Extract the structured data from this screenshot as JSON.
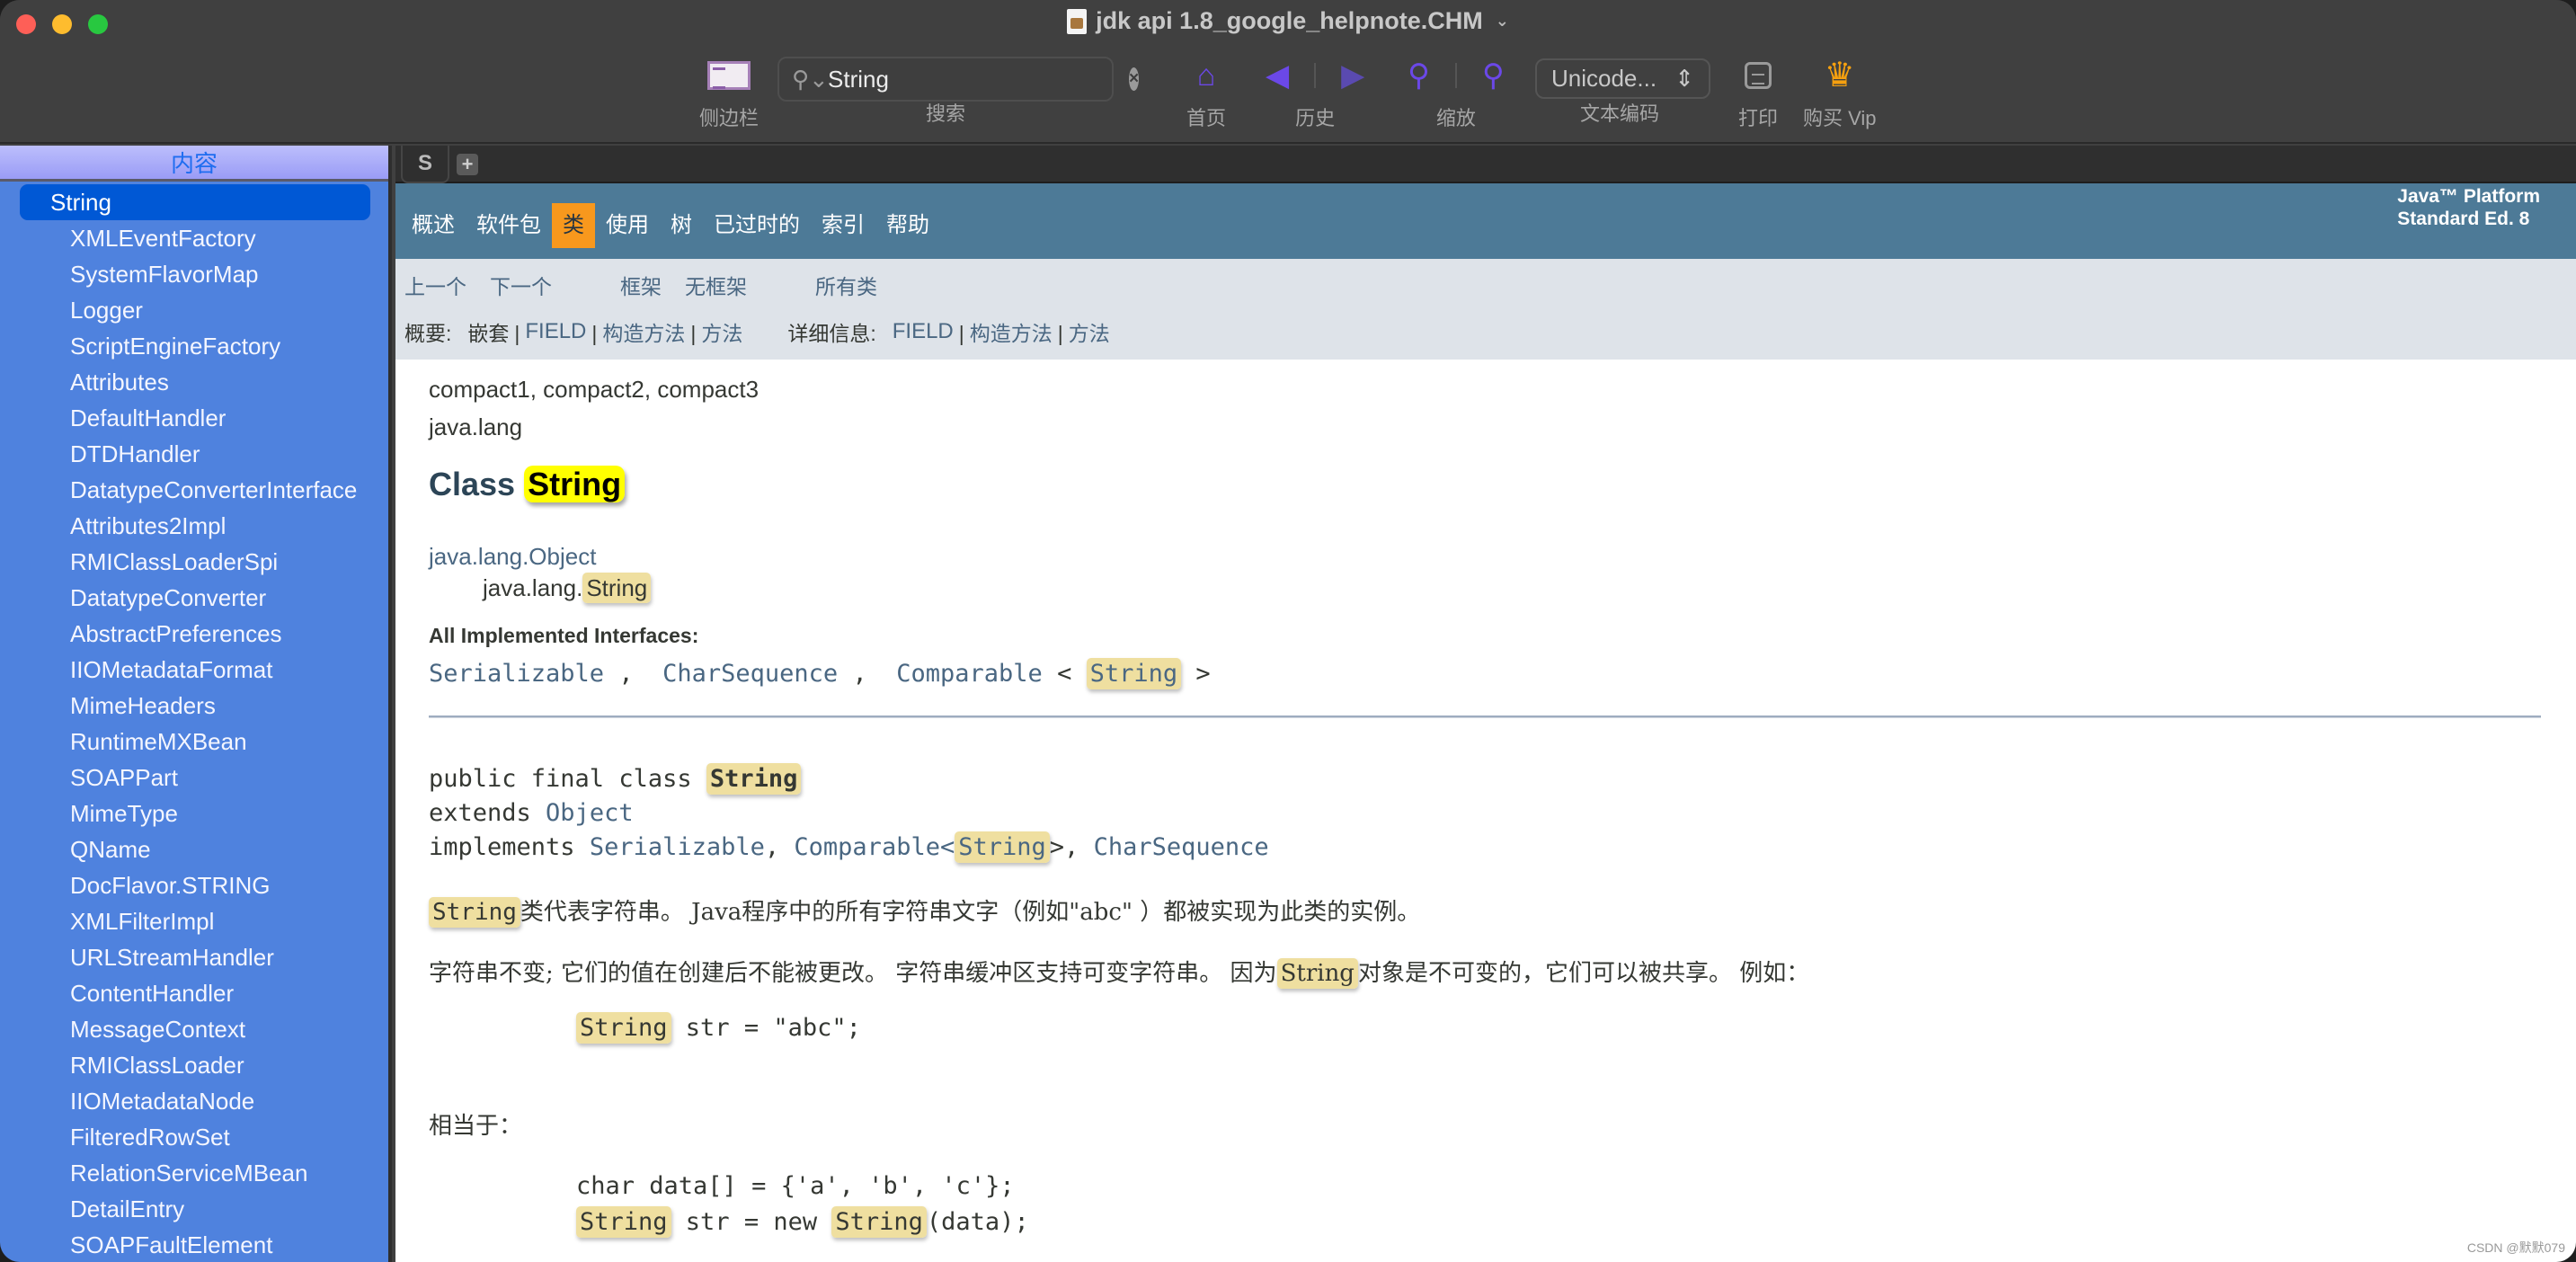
{
  "window": {
    "title": "jdk api 1.8_google_helpnote.CHM",
    "title_chevron": "⌄"
  },
  "toolbar": {
    "sidebar_label": "侧边栏",
    "search_label": "搜索",
    "search_value": "String",
    "search_clear": "×",
    "home_label": "首页",
    "history_label": "历史",
    "zoom_label": "缩放",
    "encoding_value": "Unicode...",
    "encoding_label": "文本编码",
    "print_label": "打印",
    "vip_label": "购买 Vip",
    "icons": {
      "home": "⌂",
      "back": "◀",
      "forward": "▶",
      "zoom_in": "⚲",
      "zoom_out": "⚲",
      "crown": "♛",
      "search": "⚲",
      "updown": "⇕"
    }
  },
  "sidebar": {
    "header": "内容",
    "items": [
      {
        "label": "String",
        "selected": true
      },
      {
        "label": "XMLEventFactory"
      },
      {
        "label": "SystemFlavorMap"
      },
      {
        "label": "Logger"
      },
      {
        "label": "ScriptEngineFactory"
      },
      {
        "label": "Attributes"
      },
      {
        "label": "DefaultHandler"
      },
      {
        "label": "DTDHandler"
      },
      {
        "label": "DatatypeConverterInterface"
      },
      {
        "label": "Attributes2Impl"
      },
      {
        "label": "RMIClassLoaderSpi"
      },
      {
        "label": "DatatypeConverter"
      },
      {
        "label": "AbstractPreferences"
      },
      {
        "label": "IIOMetadataFormat"
      },
      {
        "label": "MimeHeaders"
      },
      {
        "label": "RuntimeMXBean"
      },
      {
        "label": "SOAPPart"
      },
      {
        "label": "MimeType"
      },
      {
        "label": "QName"
      },
      {
        "label": "DocFlavor.STRING"
      },
      {
        "label": "XMLFilterImpl"
      },
      {
        "label": "URLStreamHandler"
      },
      {
        "label": "ContentHandler"
      },
      {
        "label": "MessageContext"
      },
      {
        "label": "RMIClassLoader"
      },
      {
        "label": "IIOMetadataNode"
      },
      {
        "label": "FilteredRowSet"
      },
      {
        "label": "RelationServiceMBean"
      },
      {
        "label": "DetailEntry"
      },
      {
        "label": "SOAPFaultElement"
      }
    ]
  },
  "tabs": {
    "active": "S",
    "add": "+"
  },
  "topnav": {
    "items": [
      "概述",
      "软件包",
      "类",
      "使用",
      "树",
      "已过时的",
      "索引",
      "帮助"
    ],
    "active_index": 2,
    "platform_line1": "Java™ Platform",
    "platform_line2": "Standard Ed. 8"
  },
  "subnav": {
    "prev": "上一个",
    "next": "下一个",
    "frames": "框架",
    "no_frames": "无框架",
    "all_classes": "所有类",
    "summary_label": "概要:",
    "summary_nested": "嵌套",
    "summary_field": "FIELD",
    "summary_constr": "构造方法",
    "summary_method": "方法",
    "detail_label": "详细信息:",
    "detail_field": "FIELD",
    "detail_constr": "构造方法",
    "detail_method": "方法",
    "pipe": "|"
  },
  "doc": {
    "profiles": "compact1, compact2, compact3",
    "package": "java.lang",
    "class_prefix": "Class",
    "class_name": "String",
    "inherit_parent": "java.lang.Object",
    "inherit_child_prefix": "java.lang.",
    "inherit_child_name": "String",
    "ifaces_title": "All Implemented Interfaces:",
    "ifaces": {
      "serializable": "Serializable",
      "charsequence": "CharSequence",
      "comparable": "Comparable",
      "type_param": "String",
      "comma": " , ",
      "lt": " < ",
      "gt": " >"
    },
    "decl": {
      "line1_prefix": "public final class ",
      "line1_name": "String",
      "line2_prefix": "extends ",
      "line2_link": "Object",
      "line3_prefix": "implements ",
      "line3_serializable": "Serializable",
      "line3_sep1": ", ",
      "line3_comparable": "Comparable",
      "line3_lt": "<",
      "line3_type": "String",
      "line3_gt": ">, ",
      "line3_charsequence": "CharSequence"
    },
    "para1_hl": "String",
    "para1_text": "类代表字符串。 Java程序中的所有字符串文字（例如\"abc\" ）都被实现为此类的实例。",
    "para2_before": "字符串不变; 它们的值在创建后不能被更改。 字符串缓冲区支持可变字符串。 因为",
    "para2_hl": "String",
    "para2_after": "对象是不可变的，它们可以被共享。 例如：",
    "code1_hl": "String",
    "code1_rest": " str = \"abc\";",
    "equiv": "相当于：",
    "code2_line1": "char data[] = {'a', 'b', 'c'};",
    "code2_hl1": "String",
    "code2_mid": " str = new ",
    "code2_hl2": "String",
    "code2_end": "(data);"
  },
  "watermark": "CSDN @默默079"
}
